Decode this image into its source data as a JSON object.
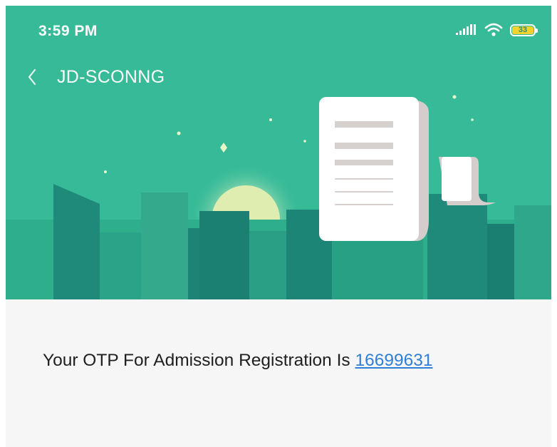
{
  "status_bar": {
    "time": "3:59 PM",
    "battery_level": "33",
    "icons": [
      "signal-icon",
      "wifi-icon",
      "battery-icon"
    ]
  },
  "nav": {
    "back_icon": "chevron-left-icon",
    "title": "JD-SCONNG"
  },
  "header": {
    "illustration": "city-skyline-with-scroll-document",
    "colors": {
      "background": "#36ba97",
      "buildings_dark": "#1c8677",
      "buildings_mid": "#2b9e88",
      "sun": "#dfeeb0"
    }
  },
  "message": {
    "text": "Your OTP For Admission Registration Is ",
    "otp": "16699631"
  },
  "colors": {
    "link": "#2e7fd8",
    "body_text": "#202020",
    "content_background": "#f6f6f6"
  }
}
